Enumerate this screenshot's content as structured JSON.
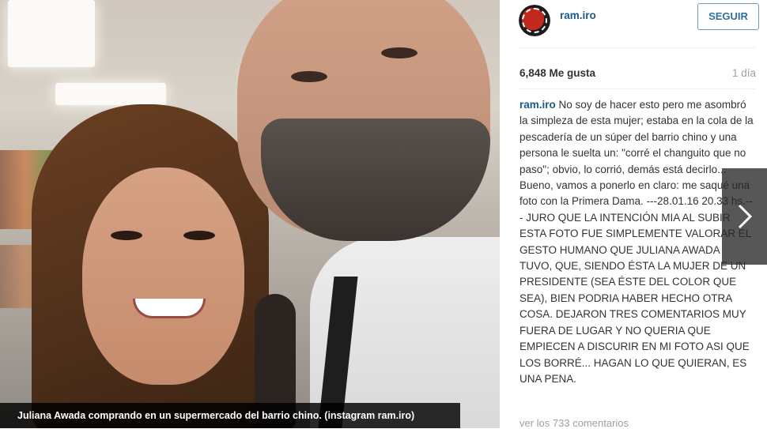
{
  "photo": {
    "caption": "Juliana Awada comprando en un supermercado del barrio chino. (instagram ram.iro)"
  },
  "post": {
    "username": "ram.iro",
    "follow_label": "SEGUIR",
    "likes": "6,848 Me gusta",
    "time": "1 día",
    "caption_user": "ram.iro",
    "caption_text": "No soy de hacer esto pero me asombró la simpleza de esta mujer; estaba en la cola de la pescadería de un súper del barrio chino y una persona le suelta un: \"corré el changuito que no paso\"; obvio, lo corrió, demás está decirlo... Bueno, vamos a ponerlo en claro: me saqué una foto con la Primera Dama. ---28.01.16 20.33 hs.--- JURO QUE LA INTENCIÓN MIA AL SUBIR ESTA FOTO FUE SIMPLEMENTE VALORAR EL GESTO HUMANO QUE JULIANA AWADA TUVO, QUE, SIENDO ÉSTA LA MUJER DE UN PRESIDENTE (SEA ÉSTE DEL COLOR QUE SEA), BIEN PODRIA HABER HECHO OTRA COSA. DEJARON TRES COMENTARIOS MUY FUERA DE LUGAR Y NO QUERIA QUE EMPIECEN A DISCURIR EN MI FOTO ASI QUE LOS BORRÉ... HAGAN LO QUE QUIERAN, ES UNA PENA.",
    "comments_link": "ver los 733 comentarios"
  },
  "icons": {
    "next": "chevron-right-icon",
    "avatar": "avatar-logo"
  },
  "colors": {
    "link": "#1a5b8c",
    "follow_border": "#6a9ac2",
    "caption_bg": "#000000"
  }
}
